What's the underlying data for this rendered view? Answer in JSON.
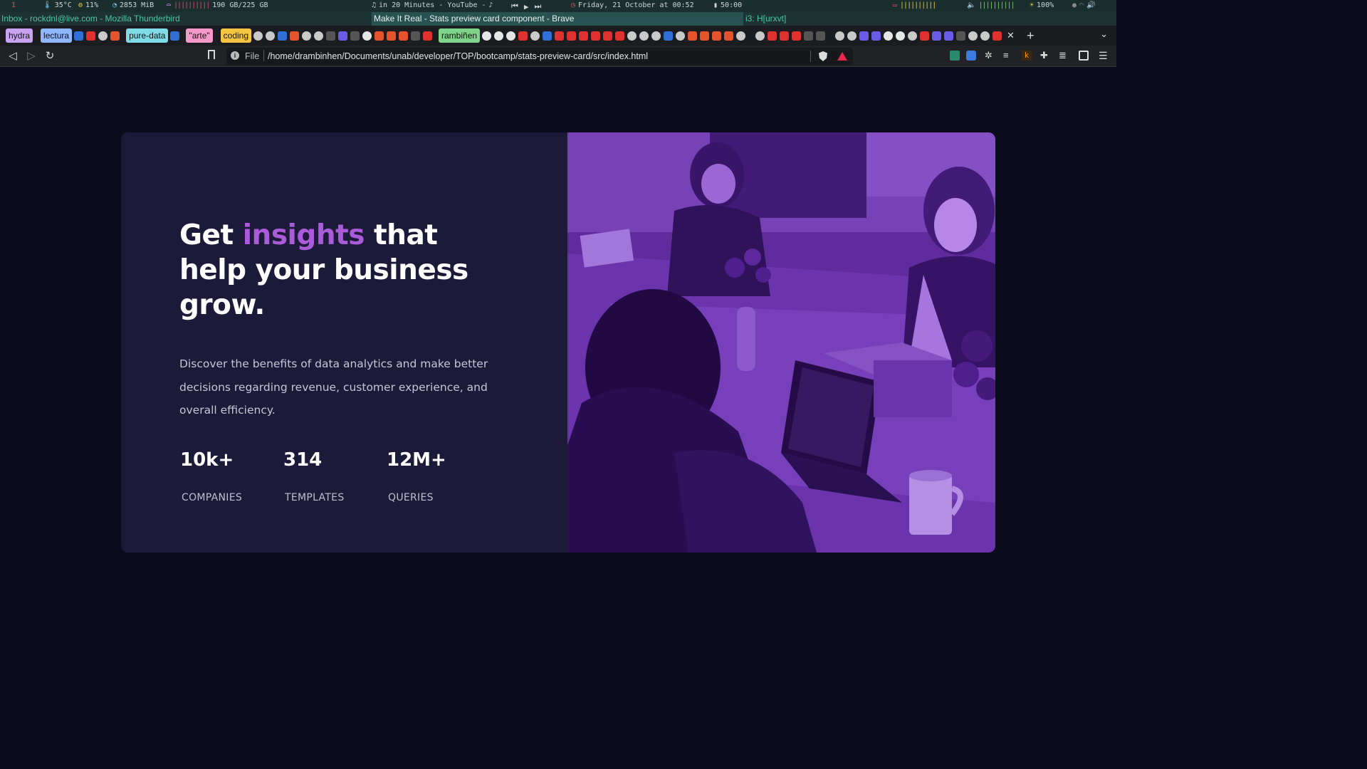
{
  "statusbar": {
    "workspace": "1",
    "temp": "35°C",
    "cpu": "11%",
    "memory": "2853 MiB",
    "disk": "190 GB/225 GB",
    "media": "in 20 Minutes - YouTube -",
    "datetime": "Friday, 21 October at 00:52",
    "battery_time": "50:00",
    "brightness": "100%"
  },
  "windows": {
    "left": "Inbox - rockdnl@live.com - Mozilla Thunderbird",
    "active": "Make It Real - Stats preview card component - Brave",
    "right": "i3: H[urxvt]"
  },
  "tab_groups": [
    {
      "label": "hydra",
      "color": "#c9a3f0"
    },
    {
      "label": "lectura",
      "color": "#8fb7ff"
    },
    {
      "label": "pure-data",
      "color": "#7fdbe6"
    },
    {
      "label": "\"arte\"",
      "color": "#f59ac8"
    },
    {
      "label": "coding",
      "color": "#f5c542"
    },
    {
      "label": "rambiñen",
      "color": "#7fd38a"
    }
  ],
  "toolbar": {
    "file_label": "File",
    "url": "/home/drambinhen/Documents/unab/developer/TOP/bootcamp/stats-preview-card/src/index.html"
  },
  "card": {
    "headline_pre": "Get ",
    "headline_accent": "insights",
    "headline_post": " that help your business grow.",
    "description": "Discover the benefits of data analytics and make better decisions regarding revenue, customer experience, and overall efficiency.",
    "stats": [
      {
        "value": "10k+",
        "label": "COMPANIES"
      },
      {
        "value": "314",
        "label": "TEMPLATES"
      },
      {
        "value": "12M+",
        "label": "QUERIES"
      }
    ]
  },
  "colors": {
    "page_bg": "#0a0b1c",
    "card_bg": "#1c1a38",
    "accent": "#aa5bd9",
    "image_tint": "#5b2d8f"
  }
}
